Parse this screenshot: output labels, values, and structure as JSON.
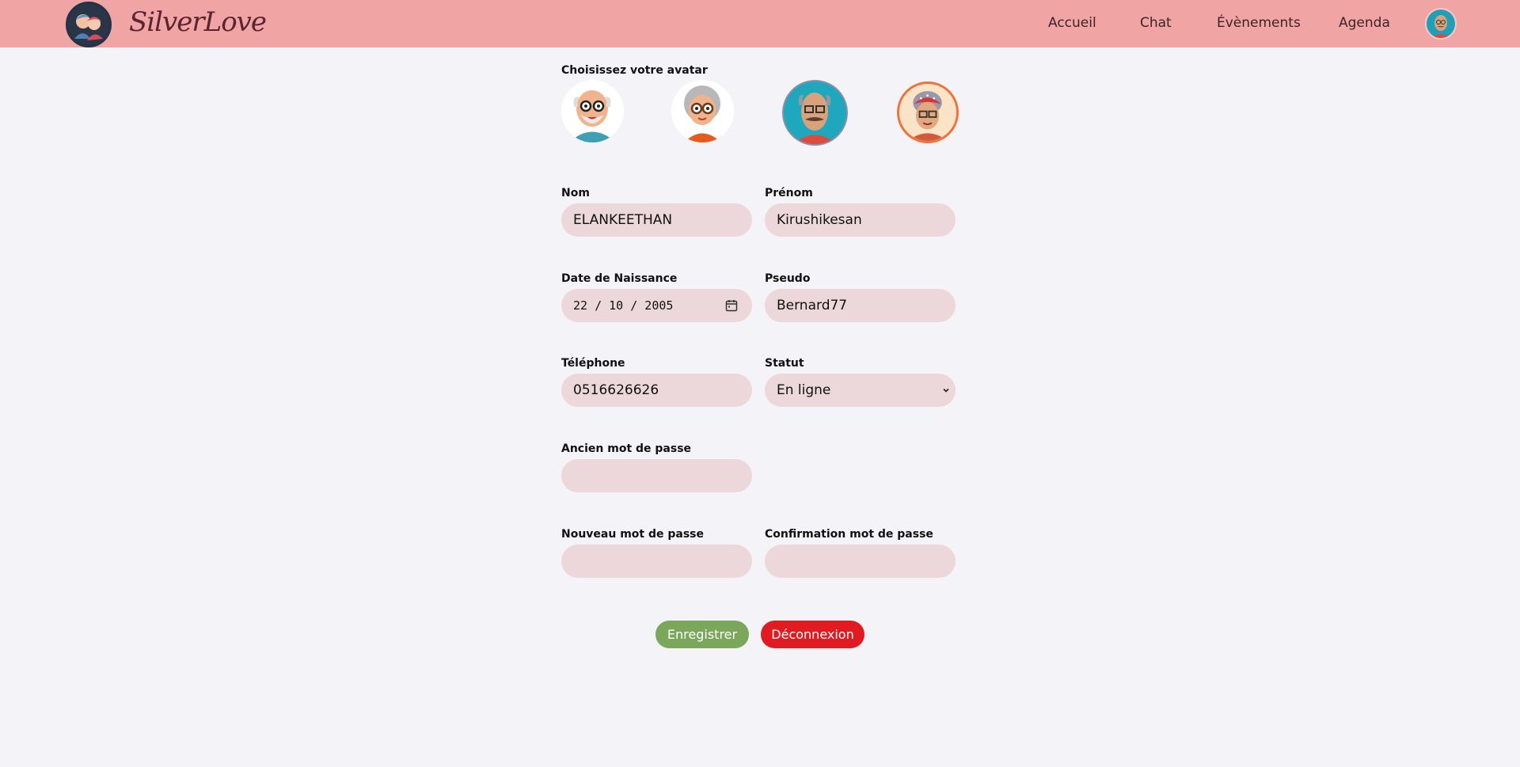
{
  "header": {
    "brand": "SilverLove",
    "nav": [
      "Accueil",
      "Chat",
      "Évènements",
      "Agenda"
    ]
  },
  "avatar_section": {
    "label": "Choisissez votre avatar",
    "avatars": [
      "grandpa-bald-glasses",
      "grandma-white-hair",
      "grandpa-mustache-selected",
      "grandma-headscarf"
    ]
  },
  "form": {
    "nom": {
      "label": "Nom",
      "value": "ELANKEETHAN"
    },
    "prenom": {
      "label": "Prénom",
      "value": "Kirushikesan"
    },
    "date": {
      "label": "Date de Naissance",
      "value": "22 / 10 / 2005"
    },
    "pseudo": {
      "label": "Pseudo",
      "value": "Bernard77"
    },
    "telephone": {
      "label": "Téléphone",
      "value": "0516626626"
    },
    "statut": {
      "label": "Statut",
      "value": "En ligne"
    },
    "ancien": {
      "label": "Ancien mot de passe",
      "value": ""
    },
    "nouveau": {
      "label": "Nouveau mot de passe",
      "value": ""
    },
    "confirmation": {
      "label": "Confirmation mot de passe",
      "value": ""
    }
  },
  "buttons": {
    "save": "Enregistrer",
    "logout": "Déconnexion"
  },
  "colors": {
    "header": "#f0a4a4",
    "field": "#ecd8da",
    "save": "#7aa75a",
    "logout": "#e01c22"
  }
}
